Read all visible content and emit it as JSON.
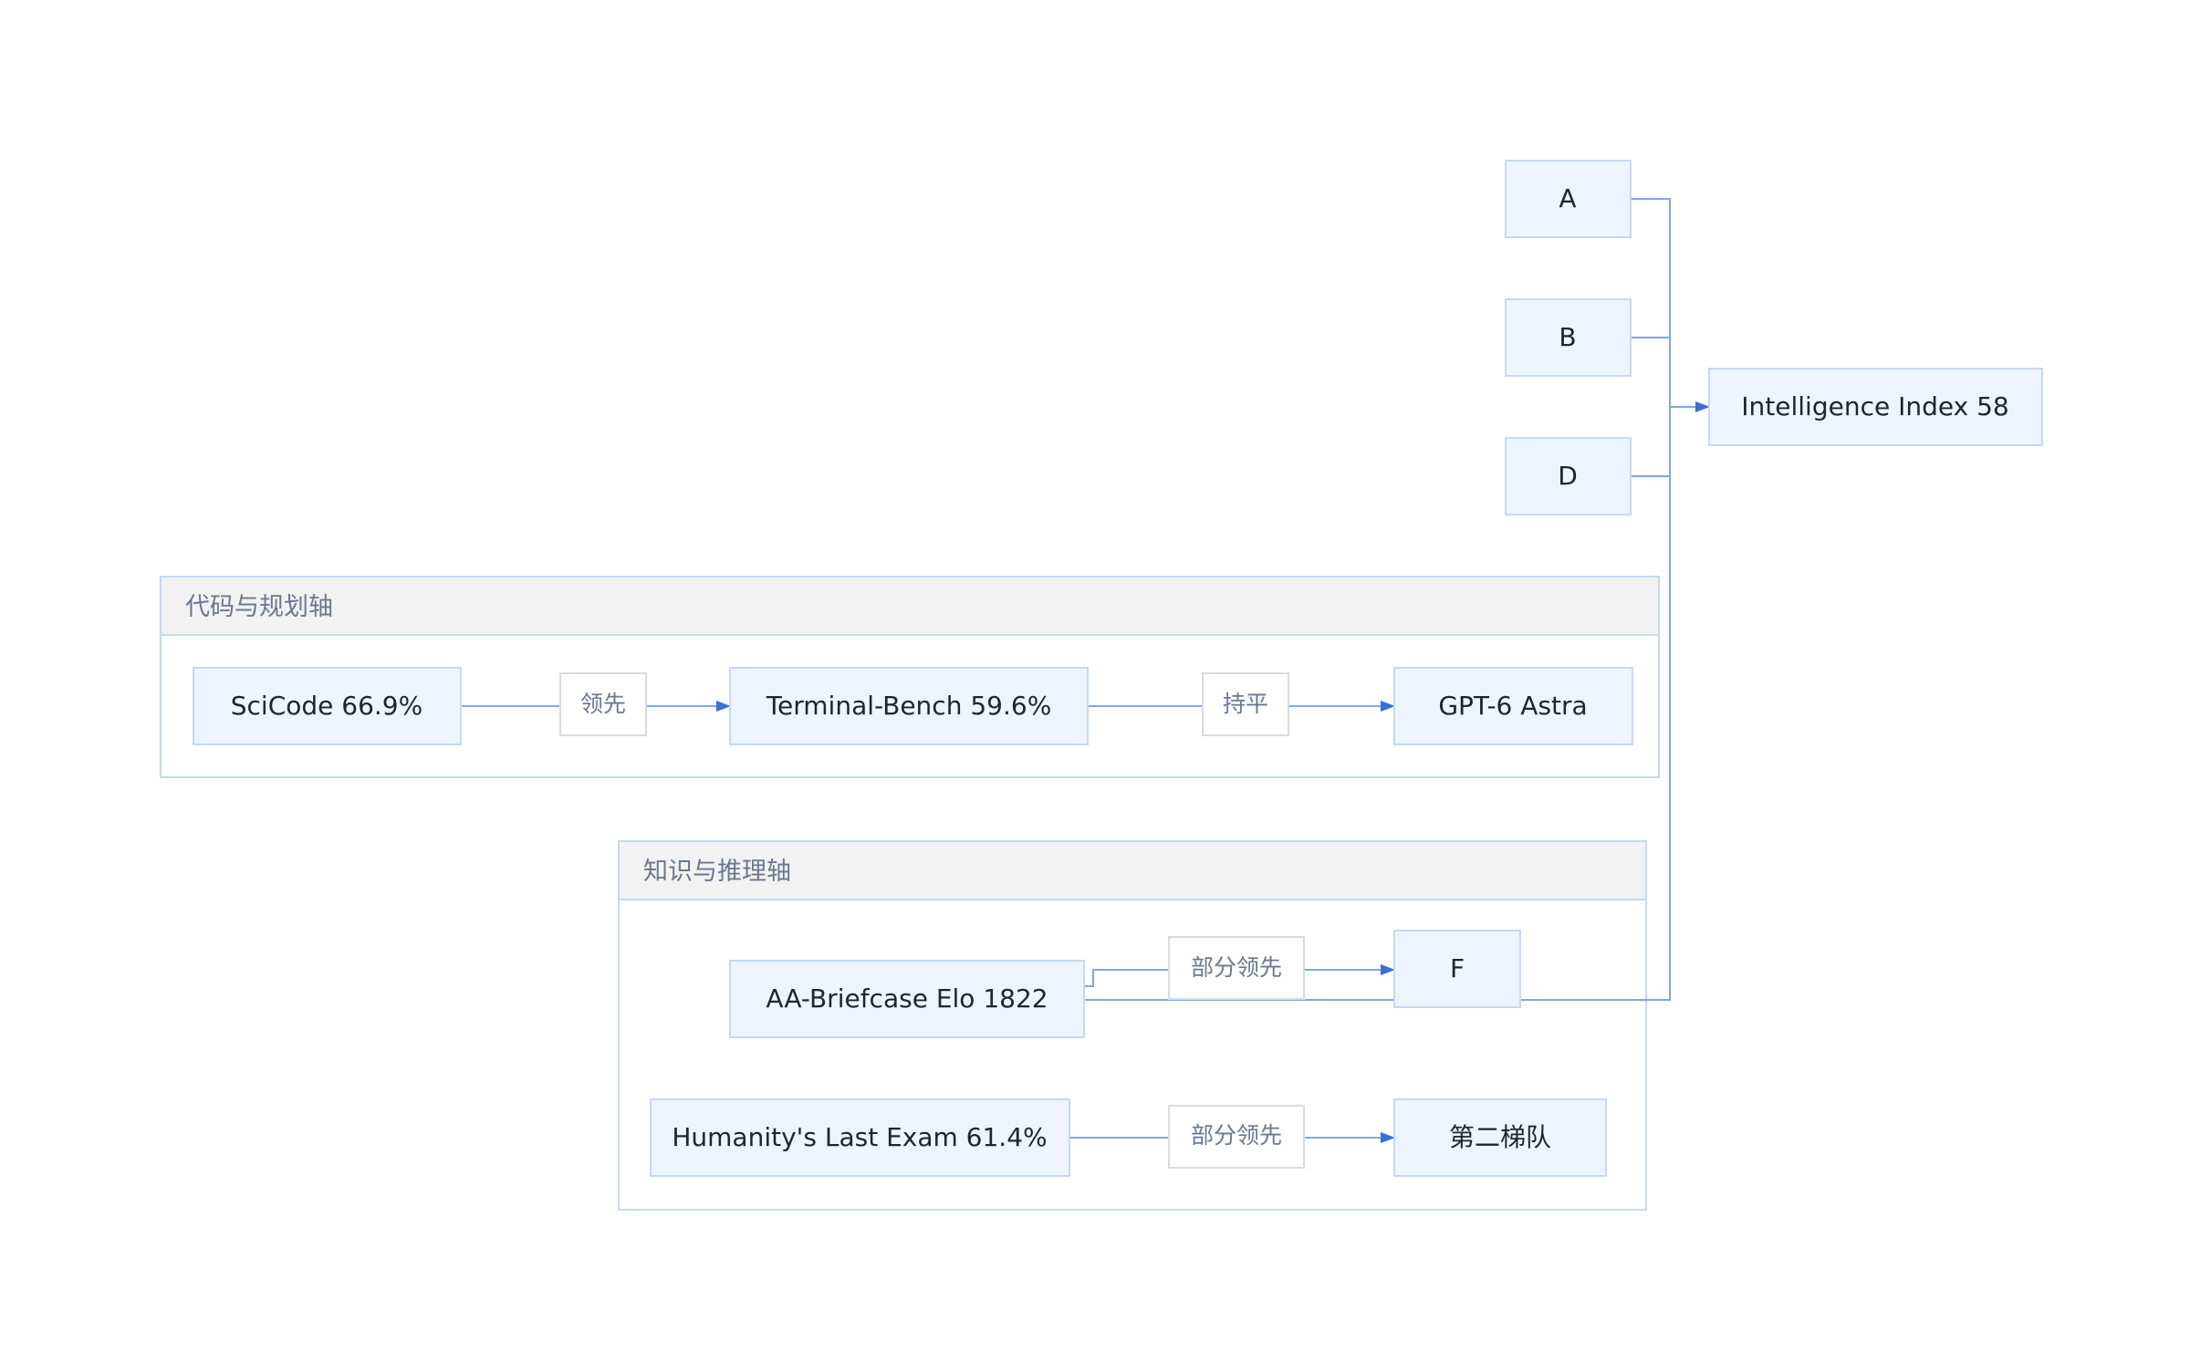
{
  "clusters": {
    "code": {
      "title": "代码与规划轴"
    },
    "knowledge": {
      "title": "知识与推理轴"
    }
  },
  "nodes": {
    "a": "A",
    "b": "B",
    "d": "D",
    "intelligence_index": "Intelligence Index 58",
    "scicode": "SciCode 66.9%",
    "terminal_bench": "Terminal-Bench 59.6%",
    "gpt6": "GPT-6 Astra",
    "aa_briefcase": "AA-Briefcase Elo 1822",
    "f": "F",
    "hle": "Humanity's Last Exam 61.4%",
    "second_tier": "第二梯队"
  },
  "edge_labels": {
    "scicode_to_terminal": "领先",
    "terminal_to_gpt6": "持平",
    "briefcase_to_f": "部分领先",
    "hle_to_second_tier": "部分领先"
  },
  "colors": {
    "node_fill": "#eef4fd",
    "node_stroke": "#c6d8f3",
    "edge": "#7ea6ea",
    "arrow": "#3a6fd8",
    "cluster_header": "#f2f2f2"
  }
}
